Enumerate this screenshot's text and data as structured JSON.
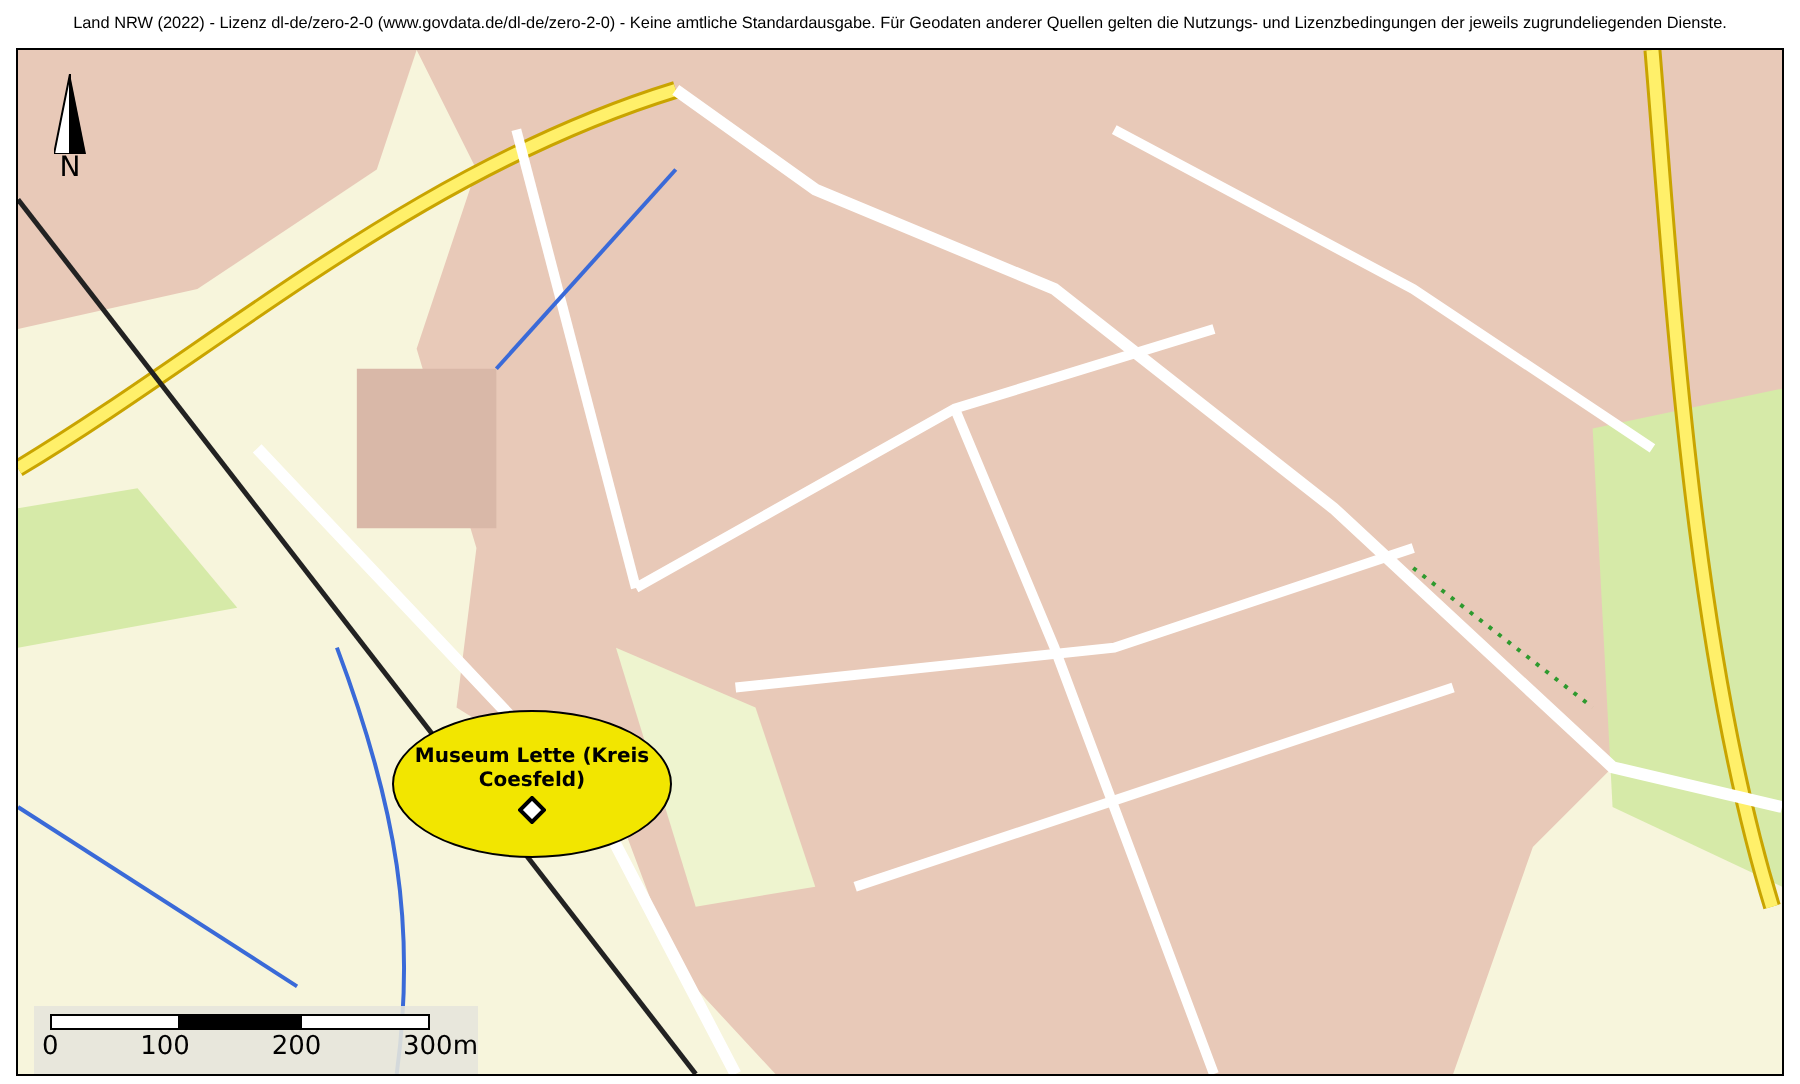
{
  "attribution": "Land NRW (2022) - Lizenz dl-de/zero-2-0 (www.govdata.de/dl-de/zero-2-0) - Keine amtliche Standardausgabe. Für Geodaten anderer Quellen gelten die Nutzungs- und Lizenzbedingungen der jeweils zugrundeliegenden Dienste.",
  "north_arrow": {
    "label": "N"
  },
  "marker": {
    "label": "Museum Lette (Kreis Coesfeld)"
  },
  "scale_bar": {
    "labels": [
      "0",
      "100",
      "200",
      "300m"
    ]
  }
}
